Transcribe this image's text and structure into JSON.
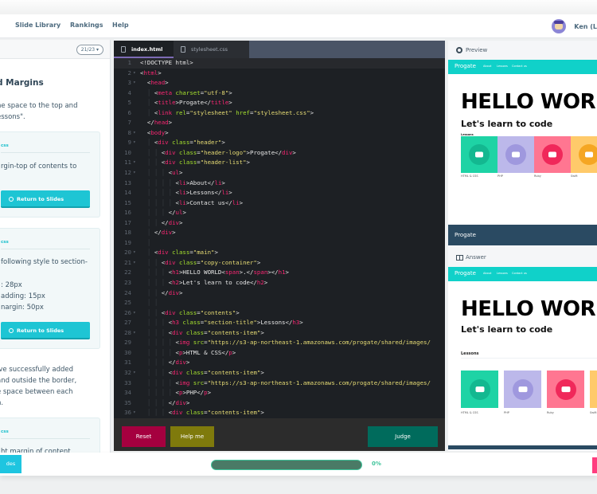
{
  "nav": {
    "items": [
      "Slide Library",
      "Rankings",
      "Help"
    ],
    "user_name": "Ken (L"
  },
  "left": {
    "page_indicator": "21/23 ▾",
    "title": "d Margins",
    "intro_lines": [
      "he space to the top and",
      "essons\"."
    ],
    "cards": [
      {
        "tag": "css",
        "lines": [
          "rgin-top of contents to"
        ],
        "button": "Return to Slides"
      },
      {
        "tag": "css",
        "lines": [
          "following style to section-",
          "",
          ": 28px",
          "adding: 15px",
          "nargin: 50px"
        ],
        "button": "Return to Slides"
      },
      {
        "tag": "css",
        "lines": [
          "ht margin of content"
        ]
      }
    ],
    "outro_lines": [
      "'ve successfully added",
      " and outside the border,",
      "e space between each",
      "n."
    ]
  },
  "editor": {
    "tabs": [
      {
        "label": "index.html",
        "active": true
      },
      {
        "label": "stylesheet.css",
        "active": false
      }
    ],
    "buttons": {
      "reset": "Reset",
      "help": "Help me",
      "judge": "Judge"
    }
  },
  "preview": {
    "preview_label": "Preview",
    "answer_label": "Answer",
    "site_logo": "Progate",
    "site_nav": [
      "About",
      "Lessons",
      "Contact us"
    ],
    "hello": "HELLO WORLD",
    "subtitle": "Let's learn to code",
    "lessons_heading": "Lessons",
    "lessons": [
      {
        "label": "HTML & CSS",
        "color": "#1ed3a5",
        "circle": "#13b890"
      },
      {
        "label": "PHP",
        "color": "#bcb8ea",
        "circle": "#9f98de"
      },
      {
        "label": "Ruby",
        "color": "#ff7691",
        "circle": "#f0285a"
      },
      {
        "label": "Swift",
        "color": "#ffca6a",
        "circle": "#f5a623"
      }
    ],
    "footer_logo": "Progate"
  },
  "bottom": {
    "slides_button": "des",
    "progress_percent": 0,
    "progress_text": "0%"
  }
}
